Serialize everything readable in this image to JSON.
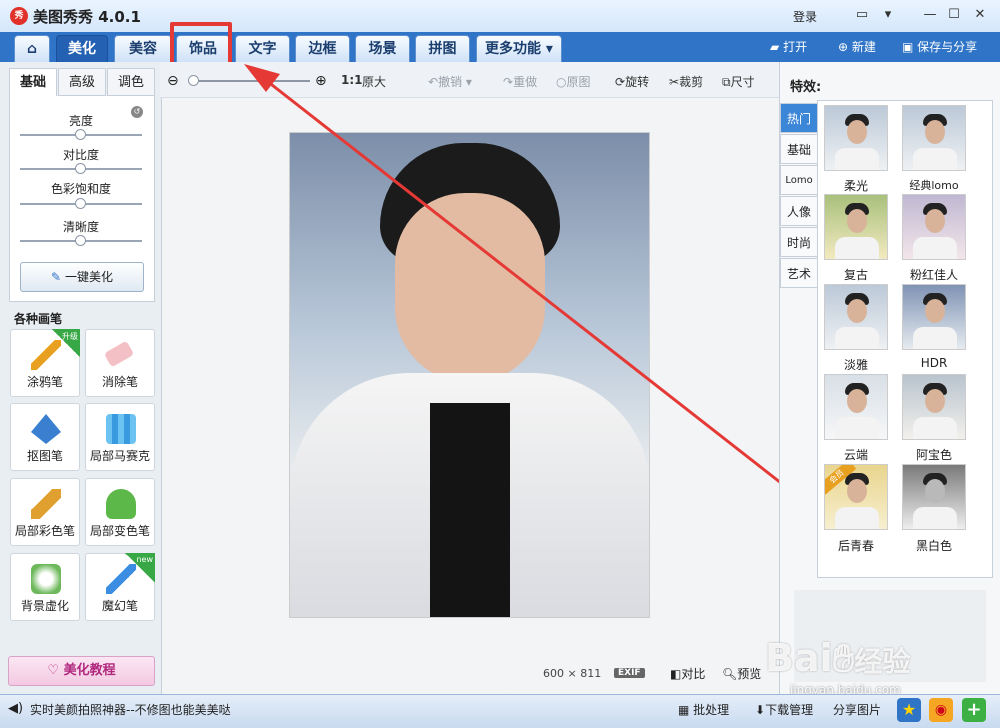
{
  "app": {
    "logo": "秀",
    "title": "美图秀秀 4.0.1",
    "login": "登录"
  },
  "nav": {
    "tabs": [
      "美化",
      "美容",
      "饰品",
      "文字",
      "边框",
      "场景",
      "拼图",
      "更多功能"
    ],
    "open": "打开",
    "new": "新建",
    "save_share": "保存与分享"
  },
  "left": {
    "subtabs": [
      "基础",
      "高级",
      "调色"
    ],
    "sliders": [
      "亮度",
      "对比度",
      "色彩饱和度",
      "清晰度"
    ],
    "one_click": "一键美化",
    "brush_title": "各种画笔",
    "brushes": [
      "涂鸦笔",
      "消除笔",
      "抠图笔",
      "局部马赛克",
      "局部彩色笔",
      "局部变色笔",
      "背景虚化",
      "魔幻笔"
    ],
    "badge_upgrade": "升级",
    "badge_new": "new",
    "tutorial": "美化教程"
  },
  "toolbar": {
    "ratio": "1:1",
    "original_size": "原大",
    "undo": "撤销",
    "redo": "重做",
    "original": "原图",
    "rotate": "旋转",
    "crop": "裁剪",
    "size": "尺寸"
  },
  "canvas": {
    "width": "600",
    "times": "×",
    "height": "811",
    "exif": "EXIF",
    "compare": "对比",
    "preview": "预览"
  },
  "right": {
    "title": "特效:",
    "tabs": [
      "热门",
      "基础",
      "Lomo",
      "人像",
      "时尚",
      "艺术"
    ],
    "effects": [
      "柔光",
      "经典lomo",
      "复古",
      "粉红佳人",
      "淡雅",
      "HDR",
      "云端",
      "阿宝色",
      "后青春",
      "黑白色"
    ],
    "vip_badge": "会员"
  },
  "status": {
    "ticker": "实时美颜拍照神器--不修图也能美美哒",
    "batch": "批处理",
    "download": "下载管理",
    "share_pic": "分享图片"
  },
  "watermark": {
    "brand": "Bai",
    "brand2": "经验",
    "url": "jingyan.baidu.com"
  },
  "colors": {
    "accent": "#2f74c7",
    "highlight": "#e53935"
  }
}
